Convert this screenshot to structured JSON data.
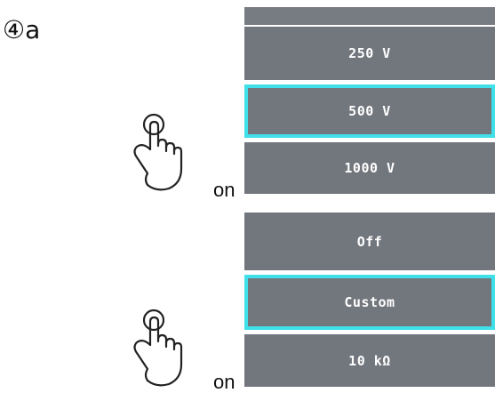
{
  "step": {
    "label": "④a"
  },
  "menus": [
    {
      "items": [
        {
          "label": "250 V",
          "selected": false
        },
        {
          "label": "500 V",
          "selected": true
        },
        {
          "label": "1000 V",
          "selected": false
        }
      ],
      "instruction": "on"
    },
    {
      "items": [
        {
          "label": "Off",
          "selected": false
        },
        {
          "label": "Custom",
          "selected": true
        },
        {
          "label": "10 kΩ",
          "selected": false
        }
      ],
      "instruction": "on"
    }
  ],
  "icons": {
    "hand": "tap-hand-icon"
  },
  "colors": {
    "menu_background": "#72767d",
    "selection_border": "#3fe0ea",
    "menu_text": "#ffffff"
  }
}
